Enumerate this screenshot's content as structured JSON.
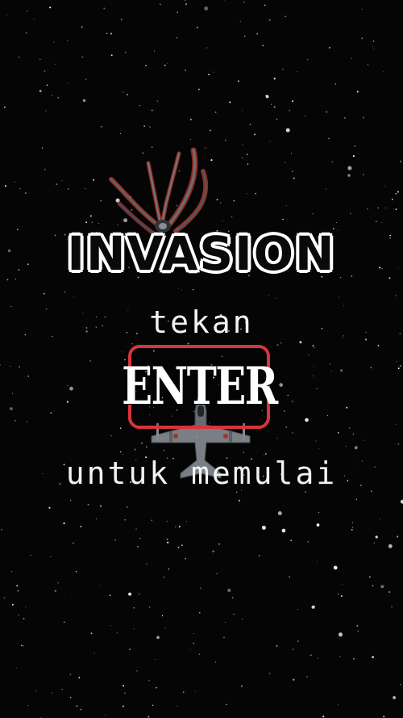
{
  "game": {
    "title": "INVASION",
    "prompt_top": "tekan",
    "enter_key_label": "ENTER",
    "prompt_bottom": "untuk memulai"
  },
  "colors": {
    "background": "#050505",
    "text": "#ffffff",
    "enter_border": "#d9343a",
    "enemy_ship_accent": "#c23a2e"
  },
  "icons": {
    "enemy": "enemy-spaceship-icon",
    "player": "fighter-jet-icon"
  }
}
